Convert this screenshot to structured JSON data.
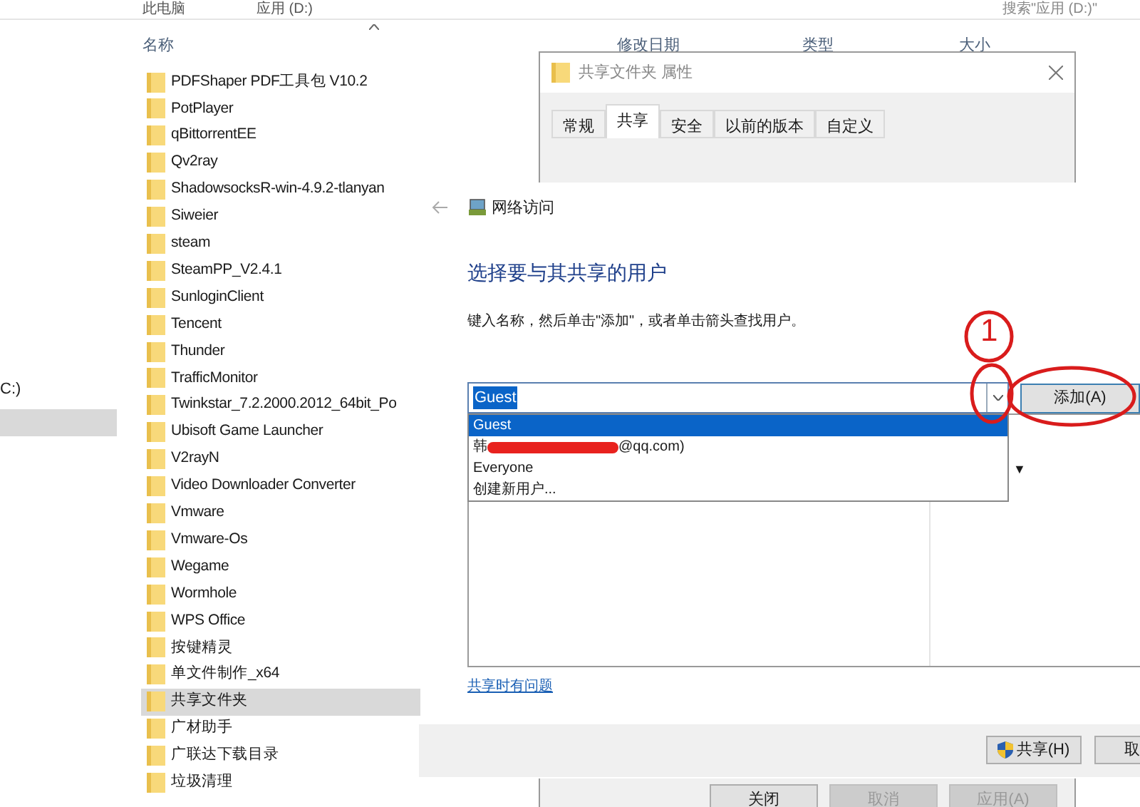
{
  "explorer": {
    "breadcrumb": [
      "此电脑",
      "应用 (D:)"
    ],
    "search": {
      "placeholder": "搜索\"应用 (D:)\""
    },
    "nav": [
      {
        "label": "C:)",
        "selected": false
      },
      {
        "selected": true
      }
    ],
    "columns": [
      "名称",
      "修改日期",
      "类型",
      "大小"
    ],
    "files": [
      {
        "name": "PDFShaper PDF工具包 V10.2",
        "selected": false
      },
      {
        "name": "PotPlayer",
        "selected": false
      },
      {
        "name": "qBittorrentEE",
        "selected": false
      },
      {
        "name": "Qv2ray",
        "selected": false
      },
      {
        "name": "ShadowsocksR-win-4.9.2-tlanyan",
        "selected": false
      },
      {
        "name": "Siweier",
        "selected": false
      },
      {
        "name": "steam",
        "selected": false
      },
      {
        "name": "SteamPP_V2.4.1",
        "selected": false
      },
      {
        "name": "SunloginClient",
        "selected": false
      },
      {
        "name": "Tencent",
        "selected": false
      },
      {
        "name": "Thunder",
        "selected": false
      },
      {
        "name": "TrafficMonitor",
        "selected": false
      },
      {
        "name": "Twinkstar_7.2.2000.2012_64bit_Po",
        "selected": false
      },
      {
        "name": "Ubisoft Game Launcher",
        "selected": false
      },
      {
        "name": "V2rayN",
        "selected": false
      },
      {
        "name": "Video Downloader Converter",
        "selected": false
      },
      {
        "name": "Vmware",
        "selected": false
      },
      {
        "name": "Vmware-Os",
        "selected": false
      },
      {
        "name": "Wegame",
        "selected": false
      },
      {
        "name": "Wormhole",
        "selected": false
      },
      {
        "name": "WPS Office",
        "selected": false
      },
      {
        "name": "按键精灵",
        "selected": false
      },
      {
        "name": "单文件制作_x64",
        "selected": false
      },
      {
        "name": "共享文件夹",
        "selected": true
      },
      {
        "name": "广材助手",
        "selected": false
      },
      {
        "name": "广联达下载目录",
        "selected": false
      },
      {
        "name": "垃圾清理",
        "selected": false
      }
    ]
  },
  "properties": {
    "title": "共享文件夹 属性",
    "tabs": [
      {
        "label": "常规",
        "selected": false
      },
      {
        "label": "共享",
        "selected": true
      },
      {
        "label": "安全",
        "selected": false
      },
      {
        "label": "以前的版本",
        "selected": false
      },
      {
        "label": "自定义",
        "selected": false
      }
    ],
    "buttons": [
      {
        "label": "关闭",
        "disabled": false
      },
      {
        "label": "取消",
        "disabled": true
      },
      {
        "label": "应用(A)",
        "disabled": true
      }
    ]
  },
  "wizard": {
    "title": "网络访问",
    "heading": "选择要与其共享的用户",
    "instruction": "键入名称，然后单击\"添加\"，或者单击箭头查找用户。",
    "combo": {
      "value": "Guest"
    },
    "add_button": "添加(A)",
    "dropdown": [
      {
        "kind": "plain",
        "label": "Guest",
        "selected": true
      },
      {
        "kind": "redacted",
        "prefix": "韩",
        "suffix": "@qq.com)",
        "selected": false
      },
      {
        "kind": "plain",
        "label": "Everyone",
        "selected": false
      },
      {
        "kind": "plain",
        "label": "创建新用户...",
        "selected": false
      }
    ],
    "list_arrow": "▼",
    "help_link": "共享时有问题",
    "share_button": "共享(H)",
    "cancel_button": "取"
  },
  "annotation": {
    "number": "1"
  }
}
